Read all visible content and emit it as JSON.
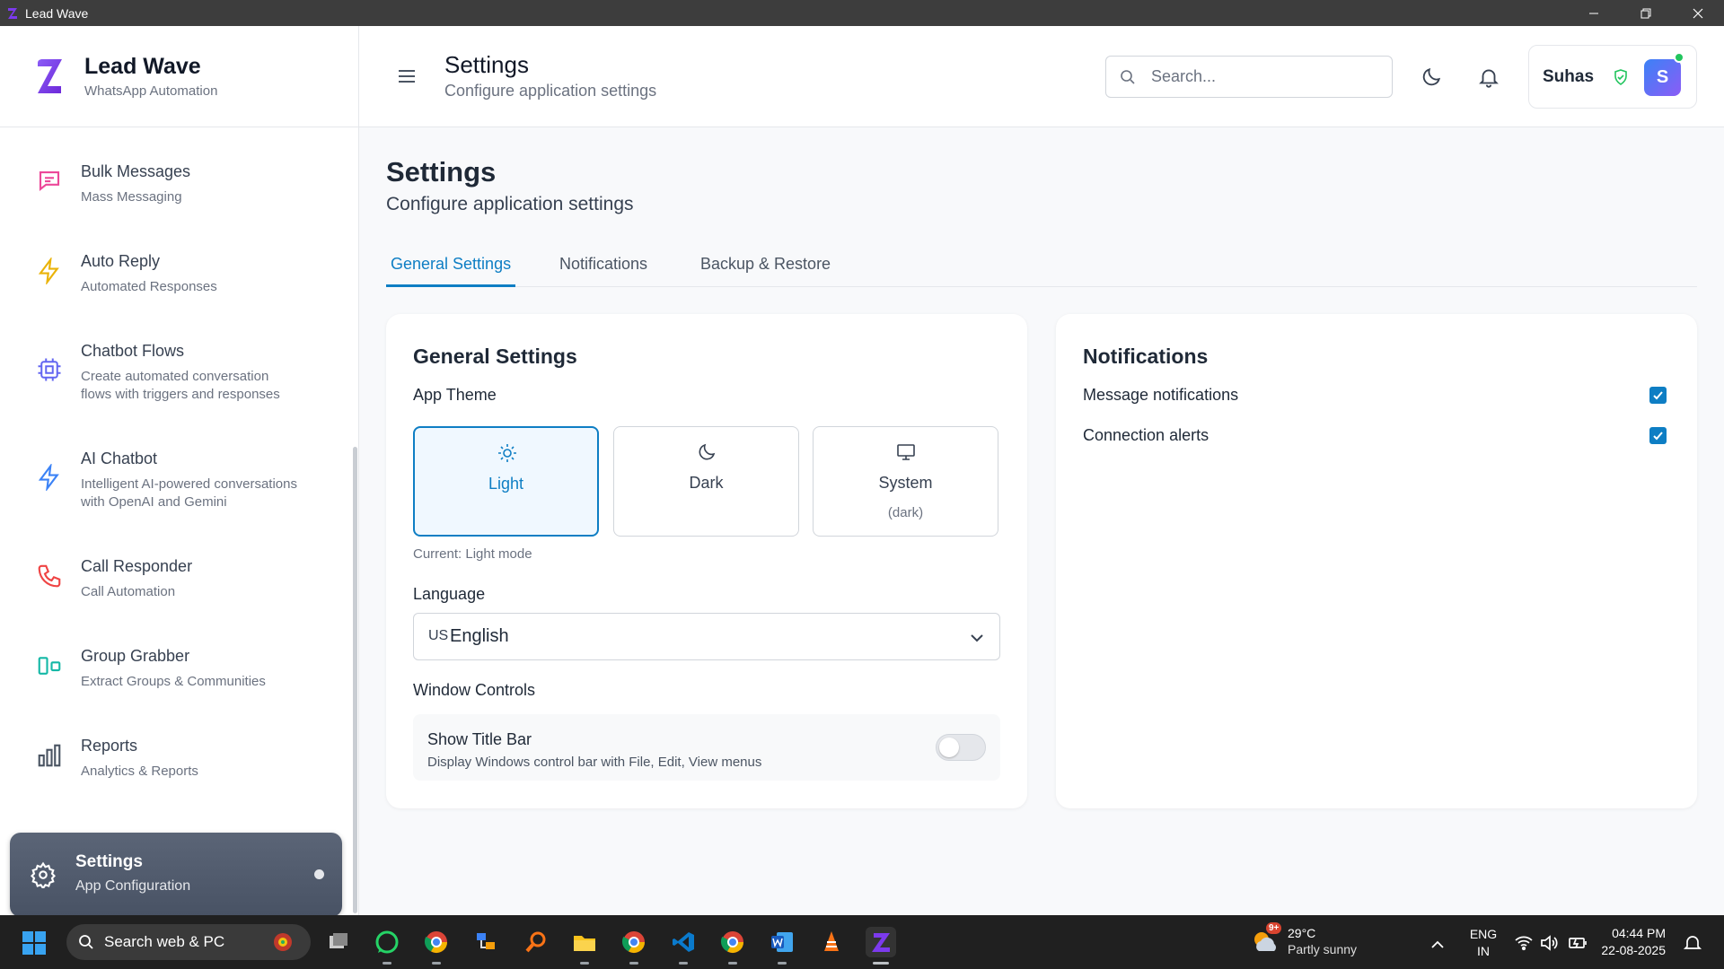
{
  "window": {
    "title": "Lead Wave"
  },
  "brand": {
    "name": "Lead Wave",
    "tagline": "WhatsApp Automation"
  },
  "sidebar": {
    "items": [
      {
        "label": "Bulk Messages",
        "sub": "Mass Messaging",
        "icon": "message-square-icon",
        "color": "#ec4899"
      },
      {
        "label": "Auto Reply",
        "sub": "Automated Responses",
        "icon": "lightning-icon",
        "color": "#eab308"
      },
      {
        "label": "Chatbot Flows",
        "sub1": "Create automated conversation",
        "sub2": "flows with triggers and responses",
        "icon": "cpu-icon",
        "color": "#6366f1"
      },
      {
        "label": "AI Chatbot",
        "sub1": "Intelligent AI-powered conversations",
        "sub2": "with OpenAI and Gemini",
        "icon": "lightning-icon",
        "color": "#3b82f6"
      },
      {
        "label": "Call Responder",
        "sub": "Call Automation",
        "icon": "phone-icon",
        "color": "#ef4444"
      },
      {
        "label": "Group Grabber",
        "sub": "Extract Groups & Communities",
        "icon": "group-icon",
        "color": "#14b8a6"
      },
      {
        "label": "Reports",
        "sub": "Analytics & Reports",
        "icon": "bar-chart-icon",
        "color": "#4b5563"
      },
      {
        "label": "Settings",
        "sub": "App Configuration",
        "icon": "gear-icon",
        "active": true
      }
    ]
  },
  "header": {
    "title": "Settings",
    "subtitle": "Configure application settings",
    "search_placeholder": "Search...",
    "user_name": "Suhas",
    "user_initial": "S"
  },
  "page": {
    "title": "Settings",
    "subtitle": "Configure application settings",
    "tabs": [
      "General Settings",
      "Notifications",
      "Backup & Restore"
    ],
    "active_tab": "General Settings"
  },
  "general": {
    "title": "General Settings",
    "theme_label": "App Theme",
    "themes": [
      {
        "label": "Light",
        "sub": "",
        "icon": "sun-icon",
        "selected": true
      },
      {
        "label": "Dark",
        "sub": "",
        "icon": "moon-icon",
        "selected": false
      },
      {
        "label": "System",
        "sub": "(dark)",
        "icon": "monitor-icon",
        "selected": false
      }
    ],
    "current_mode": "Current: Light mode",
    "language_label": "Language",
    "language_flag": "US",
    "language_value": "English",
    "window_controls_label": "Window Controls",
    "title_bar": {
      "title": "Show Title Bar",
      "desc": "Display Windows control bar with File, Edit, View menus",
      "enabled": false
    }
  },
  "notifications": {
    "title": "Notifications",
    "items": [
      {
        "label": "Message notifications",
        "checked": true
      },
      {
        "label": "Connection alerts",
        "checked": true
      }
    ]
  },
  "taskbar": {
    "search_text": "Search web & PC",
    "weather_temp": "29°C",
    "weather_cond": "Partly sunny",
    "weather_badge": "9+",
    "lang_line1": "ENG",
    "lang_line2": "IN",
    "time": "04:44 PM",
    "date": "22-08-2025"
  },
  "colors": {
    "accent": "#0e7ec4",
    "brand": "#7c3aed",
    "active_nav": "#525c6e"
  }
}
